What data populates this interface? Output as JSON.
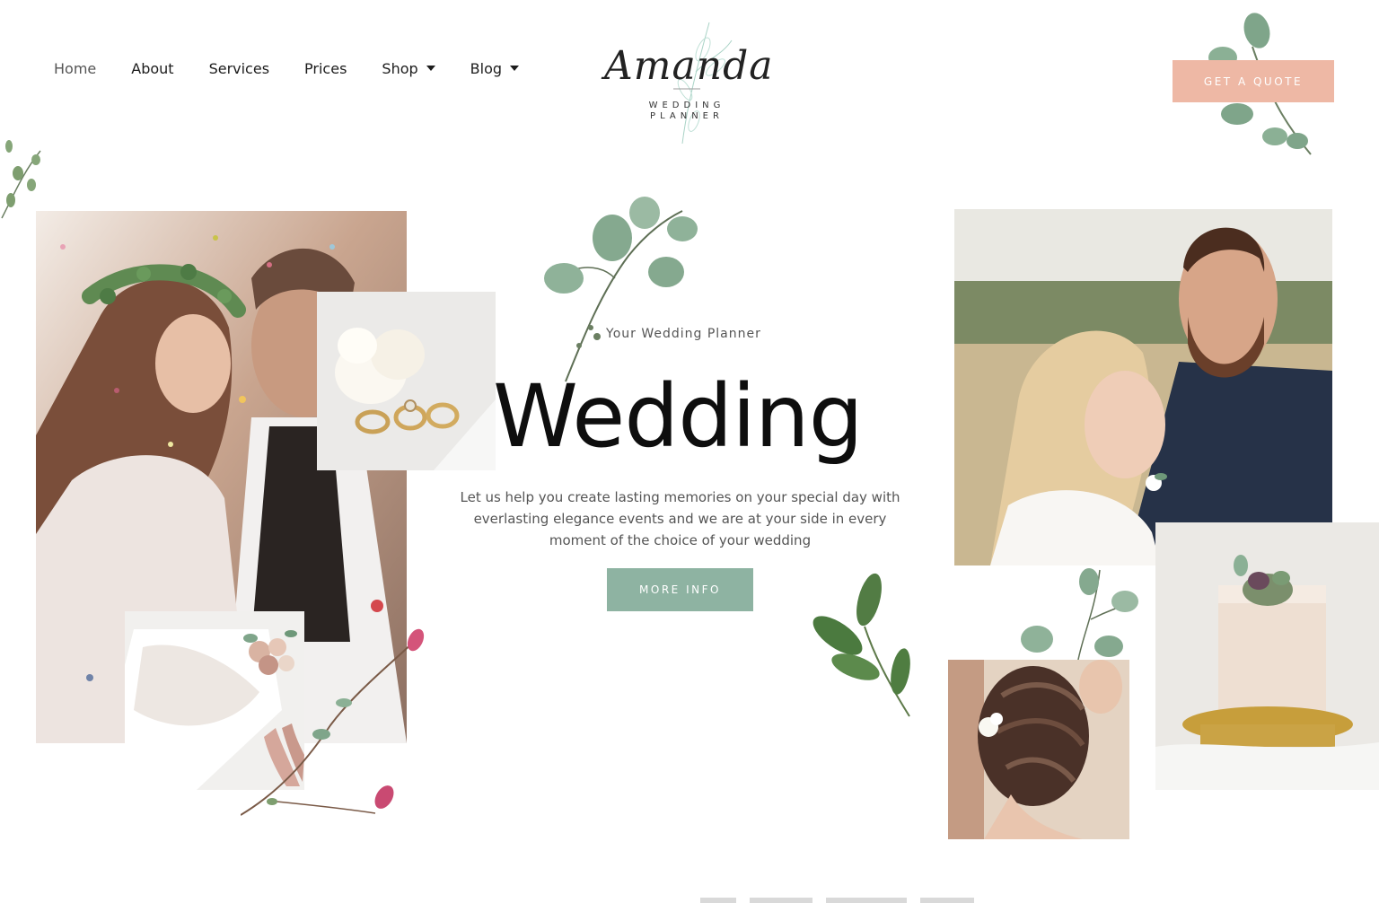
{
  "nav": {
    "items": [
      {
        "label": "Home",
        "active": true,
        "has_dropdown": false
      },
      {
        "label": "About",
        "active": false,
        "has_dropdown": false
      },
      {
        "label": "Services",
        "active": false,
        "has_dropdown": false
      },
      {
        "label": "Prices",
        "active": false,
        "has_dropdown": false
      },
      {
        "label": "Shop",
        "active": false,
        "has_dropdown": true
      },
      {
        "label": "Blog",
        "active": false,
        "has_dropdown": true
      }
    ]
  },
  "logo": {
    "script": "Amanda",
    "line1": "WEDDING",
    "line2": "PLANNER"
  },
  "header": {
    "cta_label": "GET A QUOTE"
  },
  "hero": {
    "eyebrow": "Your Wedding Planner",
    "title": "Wedding",
    "text": "Let us help you create lasting memories on your special day with everlasting elegance events and we are at your side in every moment of the choice of your wedding",
    "button_label": "MORE INFO"
  },
  "colors": {
    "quote_button": "#eeb8a5",
    "more_info_button": "#8eb3a2",
    "text_dark": "#0e0e0e",
    "text_muted": "#555555",
    "leaf_green": "#7fa58a"
  },
  "icons": [
    "chevron-down-icon",
    "eucalyptus-leaf-icon",
    "flower-branch-icon"
  ]
}
